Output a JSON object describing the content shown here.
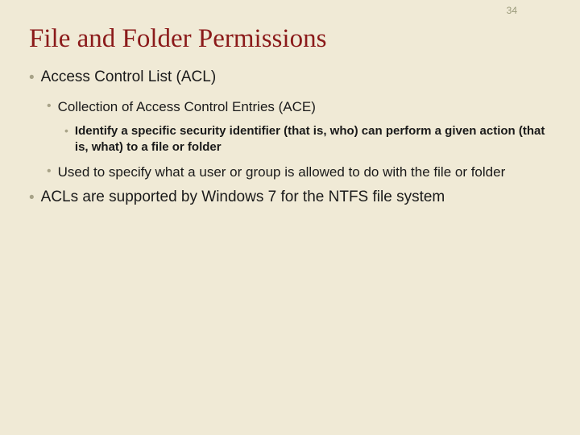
{
  "page_number": "34",
  "title": "File and Folder Permissions",
  "bullets": {
    "b1": "Access Control List (ACL)",
    "b1_1": "Collection of Access Control Entries (ACE)",
    "b1_1_1": "Identify a specific security identifier (that is, who) can perform a given action (that is, what) to a file or folder",
    "b1_2": "Used to specify what a user or group is allowed to do with the file or folder",
    "b2": "ACLs are supported by Windows 7 for the NTFS file system"
  }
}
